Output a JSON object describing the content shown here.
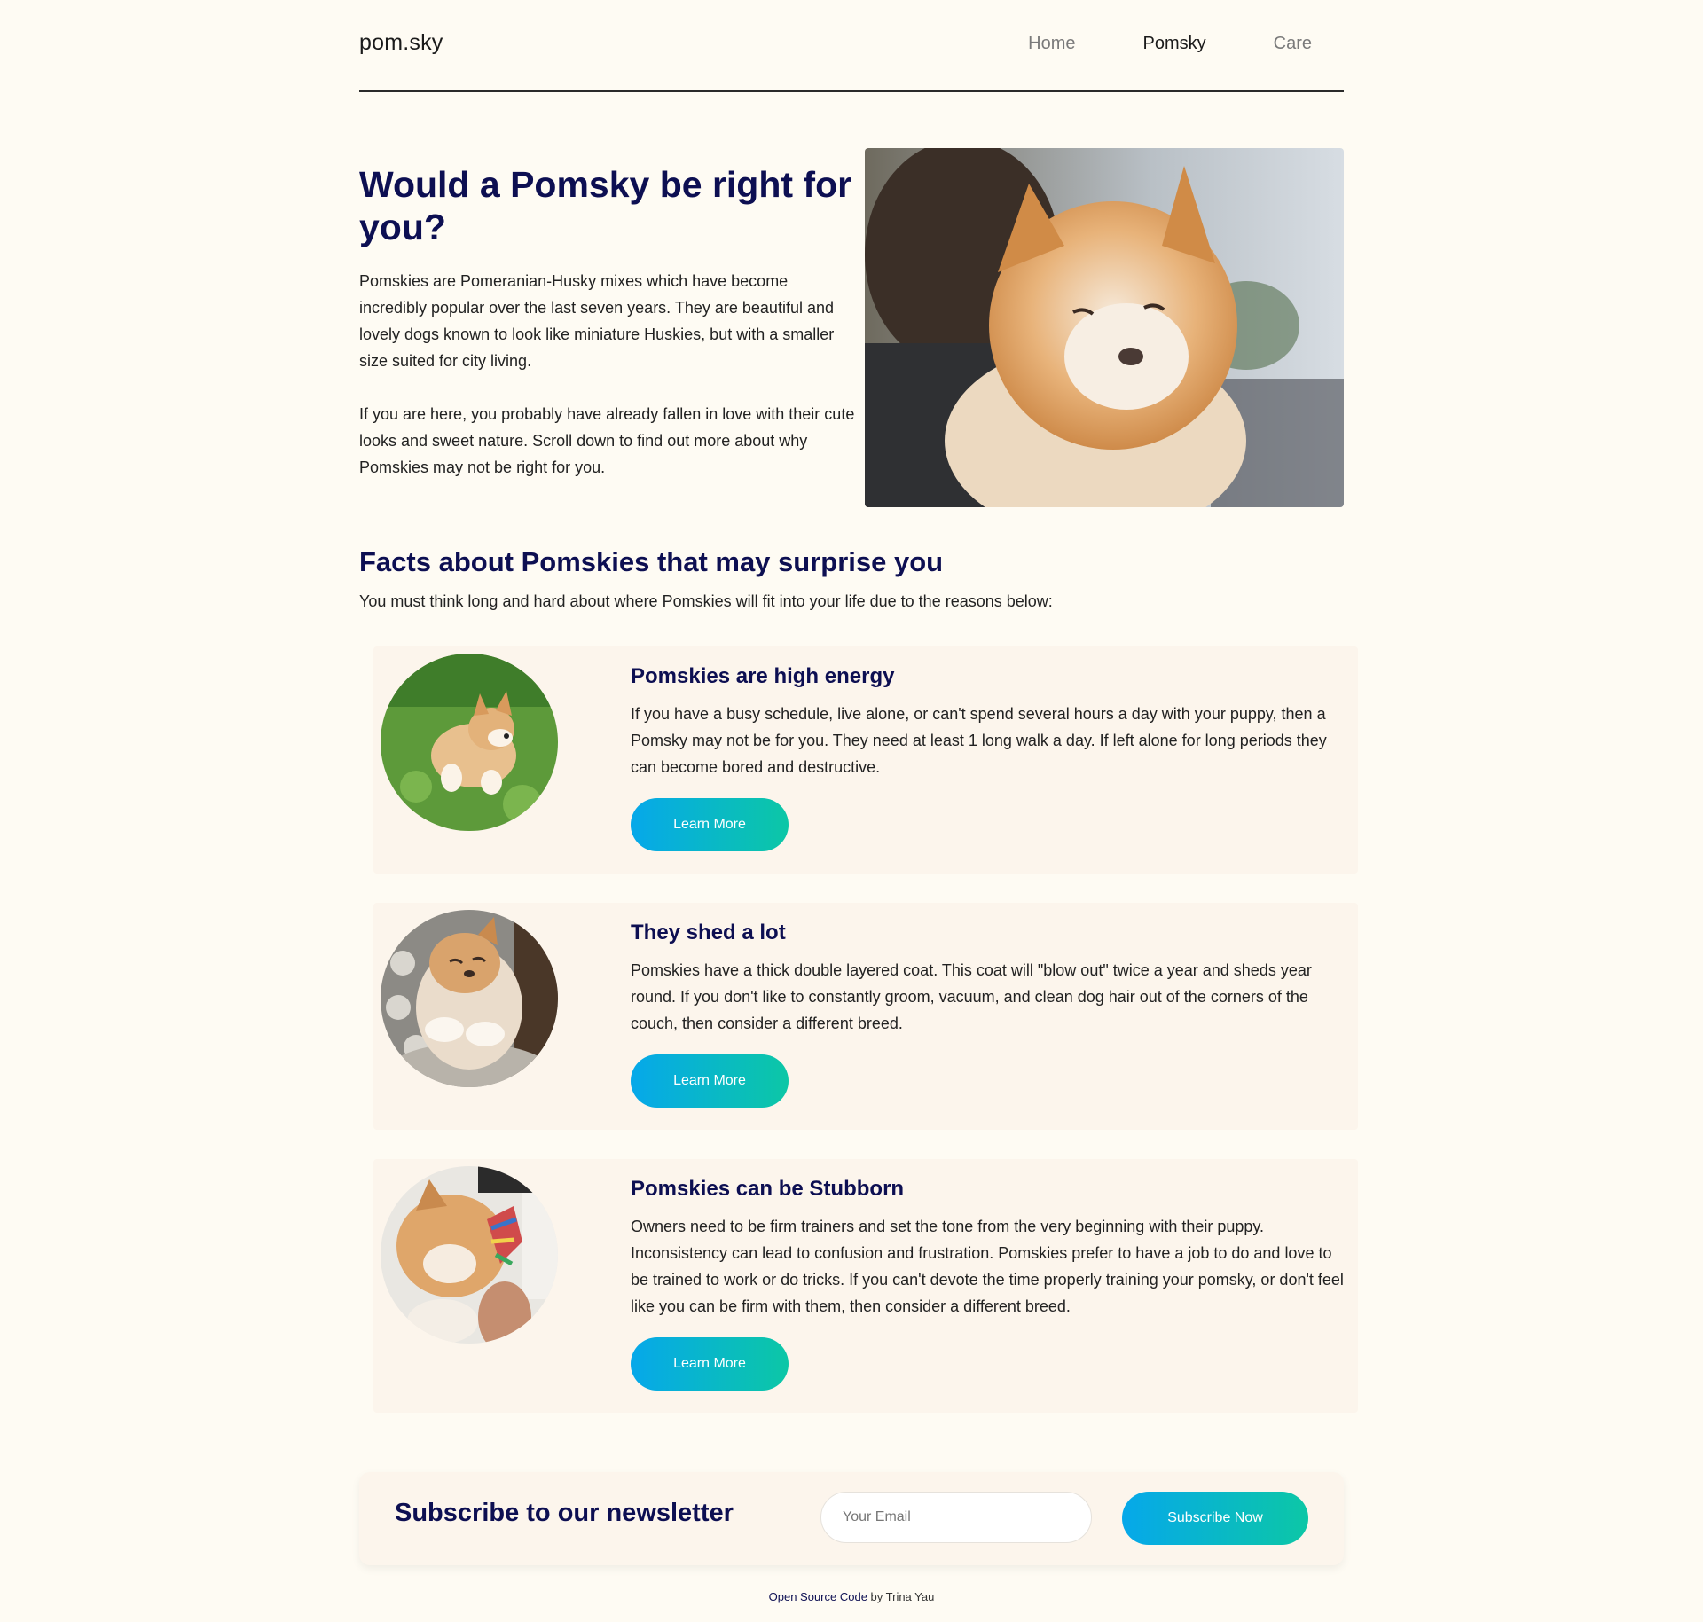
{
  "header": {
    "logo": "pom.sky",
    "nav": [
      {
        "label": "Home"
      },
      {
        "label": "Pomsky"
      },
      {
        "label": "Care"
      }
    ]
  },
  "hero": {
    "title": "Would a Pomsky be right for you?",
    "paragraphs": [
      "Pomskies are Pomeranian-Husky mixes which have become incredibly popular over the last seven years. They are beautiful and lovely dogs known to look like miniature Huskies, but with a smaller size suited for city living.",
      "If you are here, you probably have already fallen in love with their cute looks and sweet nature. Scroll down to find out more about why Pomskies may not be right for you."
    ]
  },
  "facts": {
    "title": "Facts about Pomskies that may surprise you",
    "subtitle": "You must think long and hard about where Pomskies will fit into your life due to the reasons below:",
    "cards": [
      {
        "title": "Pomskies are high energy",
        "text": "If you have a busy schedule, live alone, or can't spend several hours a day with your puppy, then a Pomsky may not be for you. They need at least 1 long walk a day. If left alone for long periods they can become bored and destructive.",
        "button": "Learn More"
      },
      {
        "title": "They shed a lot",
        "text": "Pomskies have a thick double layered coat. This coat will \"blow out\" twice a year and sheds year round. If you don't like to constantly groom, vacuum, and clean dog hair out of the corners of the couch, then consider a different breed.",
        "button": "Learn More"
      },
      {
        "title": "Pomskies can be Stubborn",
        "text": "Owners need to be firm trainers and set the tone from the very beginning with their puppy. Inconsistency can lead to confusion and frustration. Pomskies prefer to have a job to do and love to be trained to work or do tricks. If you can't devote the time properly training your pomsky, or don't feel like you can be firm with them, then consider a different breed.",
        "button": "Learn More"
      }
    ]
  },
  "newsletter": {
    "title": "Subscribe to our newsletter",
    "email_placeholder": "Your Email",
    "button": "Subscribe Now"
  },
  "footer": {
    "link": "Open Source Code",
    "text": " by Trina Yau"
  },
  "colors": {
    "background": "#fefbf3",
    "card": "#fcf5ec",
    "heading": "#0d0f52",
    "button_start": "#06a8ea",
    "button_end": "#0cc7a6"
  }
}
